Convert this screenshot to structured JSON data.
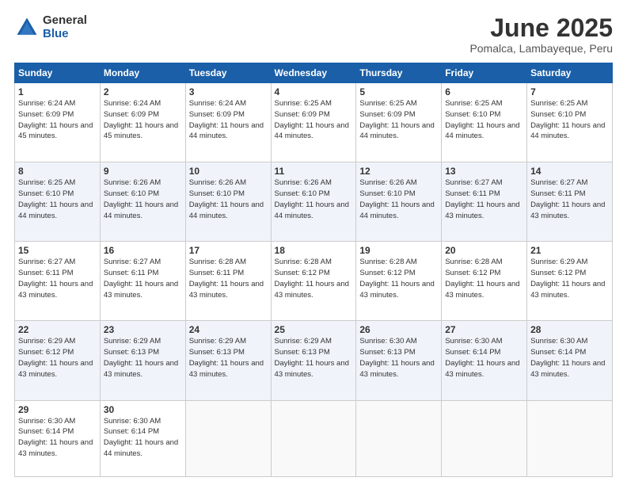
{
  "header": {
    "logo_general": "General",
    "logo_blue": "Blue",
    "main_title": "June 2025",
    "subtitle": "Pomalca, Lambayeque, Peru"
  },
  "weekdays": [
    "Sunday",
    "Monday",
    "Tuesday",
    "Wednesday",
    "Thursday",
    "Friday",
    "Saturday"
  ],
  "weeks": [
    [
      {
        "day": "1",
        "sunrise": "6:24 AM",
        "sunset": "6:09 PM",
        "daylight": "11 hours and 45 minutes."
      },
      {
        "day": "2",
        "sunrise": "6:24 AM",
        "sunset": "6:09 PM",
        "daylight": "11 hours and 45 minutes."
      },
      {
        "day": "3",
        "sunrise": "6:24 AM",
        "sunset": "6:09 PM",
        "daylight": "11 hours and 44 minutes."
      },
      {
        "day": "4",
        "sunrise": "6:25 AM",
        "sunset": "6:09 PM",
        "daylight": "11 hours and 44 minutes."
      },
      {
        "day": "5",
        "sunrise": "6:25 AM",
        "sunset": "6:09 PM",
        "daylight": "11 hours and 44 minutes."
      },
      {
        "day": "6",
        "sunrise": "6:25 AM",
        "sunset": "6:10 PM",
        "daylight": "11 hours and 44 minutes."
      },
      {
        "day": "7",
        "sunrise": "6:25 AM",
        "sunset": "6:10 PM",
        "daylight": "11 hours and 44 minutes."
      }
    ],
    [
      {
        "day": "8",
        "sunrise": "6:25 AM",
        "sunset": "6:10 PM",
        "daylight": "11 hours and 44 minutes."
      },
      {
        "day": "9",
        "sunrise": "6:26 AM",
        "sunset": "6:10 PM",
        "daylight": "11 hours and 44 minutes."
      },
      {
        "day": "10",
        "sunrise": "6:26 AM",
        "sunset": "6:10 PM",
        "daylight": "11 hours and 44 minutes."
      },
      {
        "day": "11",
        "sunrise": "6:26 AM",
        "sunset": "6:10 PM",
        "daylight": "11 hours and 44 minutes."
      },
      {
        "day": "12",
        "sunrise": "6:26 AM",
        "sunset": "6:10 PM",
        "daylight": "11 hours and 44 minutes."
      },
      {
        "day": "13",
        "sunrise": "6:27 AM",
        "sunset": "6:11 PM",
        "daylight": "11 hours and 43 minutes."
      },
      {
        "day": "14",
        "sunrise": "6:27 AM",
        "sunset": "6:11 PM",
        "daylight": "11 hours and 43 minutes."
      }
    ],
    [
      {
        "day": "15",
        "sunrise": "6:27 AM",
        "sunset": "6:11 PM",
        "daylight": "11 hours and 43 minutes."
      },
      {
        "day": "16",
        "sunrise": "6:27 AM",
        "sunset": "6:11 PM",
        "daylight": "11 hours and 43 minutes."
      },
      {
        "day": "17",
        "sunrise": "6:28 AM",
        "sunset": "6:11 PM",
        "daylight": "11 hours and 43 minutes."
      },
      {
        "day": "18",
        "sunrise": "6:28 AM",
        "sunset": "6:12 PM",
        "daylight": "11 hours and 43 minutes."
      },
      {
        "day": "19",
        "sunrise": "6:28 AM",
        "sunset": "6:12 PM",
        "daylight": "11 hours and 43 minutes."
      },
      {
        "day": "20",
        "sunrise": "6:28 AM",
        "sunset": "6:12 PM",
        "daylight": "11 hours and 43 minutes."
      },
      {
        "day": "21",
        "sunrise": "6:29 AM",
        "sunset": "6:12 PM",
        "daylight": "11 hours and 43 minutes."
      }
    ],
    [
      {
        "day": "22",
        "sunrise": "6:29 AM",
        "sunset": "6:12 PM",
        "daylight": "11 hours and 43 minutes."
      },
      {
        "day": "23",
        "sunrise": "6:29 AM",
        "sunset": "6:13 PM",
        "daylight": "11 hours and 43 minutes."
      },
      {
        "day": "24",
        "sunrise": "6:29 AM",
        "sunset": "6:13 PM",
        "daylight": "11 hours and 43 minutes."
      },
      {
        "day": "25",
        "sunrise": "6:29 AM",
        "sunset": "6:13 PM",
        "daylight": "11 hours and 43 minutes."
      },
      {
        "day": "26",
        "sunrise": "6:30 AM",
        "sunset": "6:13 PM",
        "daylight": "11 hours and 43 minutes."
      },
      {
        "day": "27",
        "sunrise": "6:30 AM",
        "sunset": "6:14 PM",
        "daylight": "11 hours and 43 minutes."
      },
      {
        "day": "28",
        "sunrise": "6:30 AM",
        "sunset": "6:14 PM",
        "daylight": "11 hours and 43 minutes."
      }
    ],
    [
      {
        "day": "29",
        "sunrise": "6:30 AM",
        "sunset": "6:14 PM",
        "daylight": "11 hours and 43 minutes."
      },
      {
        "day": "30",
        "sunrise": "6:30 AM",
        "sunset": "6:14 PM",
        "daylight": "11 hours and 44 minutes."
      },
      null,
      null,
      null,
      null,
      null
    ]
  ],
  "labels": {
    "sunrise": "Sunrise:",
    "sunset": "Sunset:",
    "daylight": "Daylight:"
  }
}
